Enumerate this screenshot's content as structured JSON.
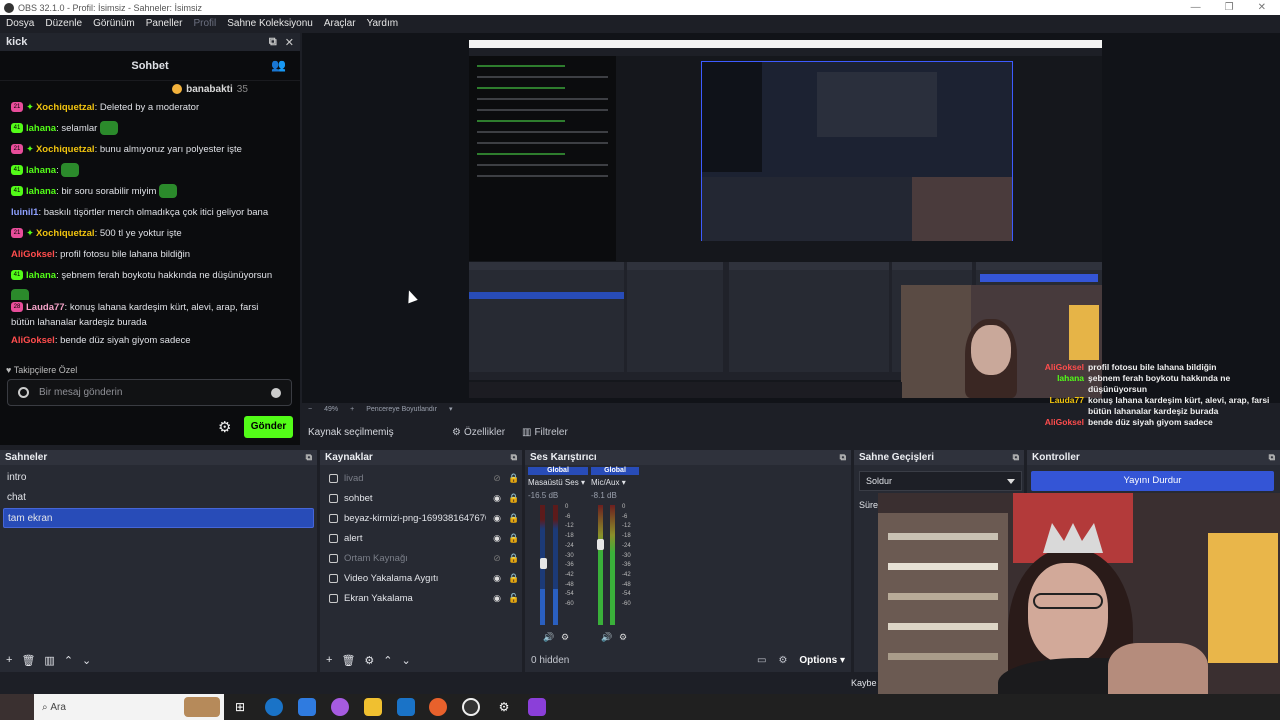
{
  "window": {
    "title": "OBS 32.1.0 - Profil: İsimsiz - Sahneler: İsimsiz",
    "controls": [
      "—",
      "❐",
      "✕"
    ]
  },
  "menu": [
    "Dosya",
    "Düzenle",
    "Görünüm",
    "Paneller",
    "Profil",
    "Sahne Koleksiyonu",
    "Araçlar",
    "Yardım"
  ],
  "chat_dock": {
    "title": "kick",
    "chat_title": "Sohbet",
    "pinned_user": "banabakti",
    "pinned_count": "35",
    "messages": [
      {
        "user": "Xochiquetzal",
        "text": ": Deleted by a moderator",
        "badge": "21",
        "color": "yellow"
      },
      {
        "user": "lahana",
        "text": ": selamlar",
        "badge": "41",
        "color": "green"
      },
      {
        "user": "Xochiquetzal",
        "text": ": bunu almıyoruz yarı polyester işte",
        "badge": "21",
        "color": "yellow"
      },
      {
        "user": "lahana",
        "text": ":",
        "badge": "41",
        "color": "green"
      },
      {
        "user": "lahana",
        "text": ": bir soru sorabilir miyim",
        "badge": "41",
        "color": "green"
      },
      {
        "user": "luinil1",
        "text": ": baskılı tişörtler merch olmadıkça çok itici geliyor bana",
        "badge": "",
        "color": "blue"
      },
      {
        "user": "Xochiquetzal",
        "text": ": 500 tl ye yoktur işte",
        "badge": "21",
        "color": "yellow"
      },
      {
        "user": "AliGoksel",
        "text": ": profil fotosu bile lahana bildiğin",
        "badge": "",
        "color": "red"
      },
      {
        "user": "lahana",
        "text": ": şebnem ferah boykotu hakkında ne düşünüyorsun",
        "badge": "41",
        "color": "green"
      },
      {
        "user": "Lauda77",
        "text": ": konuş lahana kardeşim kürt, alevi, arap, farsi",
        "badge": "28",
        "color": "pink"
      },
      {
        "user": "",
        "text": "bütün lahanalar kardeşiz burada",
        "badge": "",
        "color": "none"
      },
      {
        "user": "AliGoksel",
        "text": ": bende düz siyah giyom sadece",
        "badge": "",
        "color": "red"
      }
    ],
    "followers_label": "Takipçilere Özel",
    "input_placeholder": "Bir mesaj gönderin",
    "send_label": "Gönder"
  },
  "overlay_chat": [
    {
      "user": "AliGoksel",
      "text": "profil fotosu bile lahana bildiğin"
    },
    {
      "user": "lahana",
      "text": "şebnem ferah boykotu hakkında ne düşünüyorsun"
    },
    {
      "user": "Lauda77",
      "text": "konuş lahana kardeşim kürt, alevi, arap, farsi bütün lahanalar kardeşiz burada"
    },
    {
      "user": "AliGoksel",
      "text": "bende düz siyah giyom sadece"
    }
  ],
  "preview_bar": {
    "zoom": "49%",
    "fit_label": "Pencereye Boyutlandır",
    "no_source": "Kaynak seçilmemiş",
    "properties": "Özellikler",
    "filters": "Filtreler"
  },
  "scenes": {
    "title": "Sahneler",
    "items": [
      "intro",
      "chat",
      "tam ekran"
    ],
    "selected": "tam ekran"
  },
  "sources": {
    "title": "Kaynaklar",
    "items": [
      {
        "name": "livad",
        "dim": true
      },
      {
        "name": "sohbet",
        "dim": false
      },
      {
        "name": "beyaz-kirmizi-png-1699381647670.p",
        "dim": false
      },
      {
        "name": "alert",
        "dim": false
      },
      {
        "name": "Ortam Kaynağı",
        "dim": true
      },
      {
        "name": "Video Yakalama Aygıtı",
        "dim": false
      },
      {
        "name": "Ekran Yakalama",
        "dim": false
      }
    ]
  },
  "mixer": {
    "title": "Ses Karıştırıcı",
    "channels": [
      {
        "global": "Global",
        "name": "Masaüstü Ses",
        "db": "-16.5 dB",
        "level": 0.55
      },
      {
        "global": "Global",
        "name": "Mic/Aux",
        "db": "-8.1 dB",
        "level": 0.7
      }
    ],
    "ticks": [
      "0",
      "-6",
      "-12",
      "-18",
      "-24",
      "-30",
      "-36",
      "-42",
      "-48",
      "-54",
      "-60"
    ],
    "hidden": "0 hidden",
    "options": "Options"
  },
  "transitions": {
    "title": "Sahne Geçişleri",
    "selected": "Soldur",
    "duration_label": "Süre"
  },
  "controls": {
    "title": "Kontroller",
    "stop_label": "Yayını Durdur"
  },
  "status": {
    "tail": "Kaybe"
  },
  "taskbar": {
    "search": "Ara"
  }
}
